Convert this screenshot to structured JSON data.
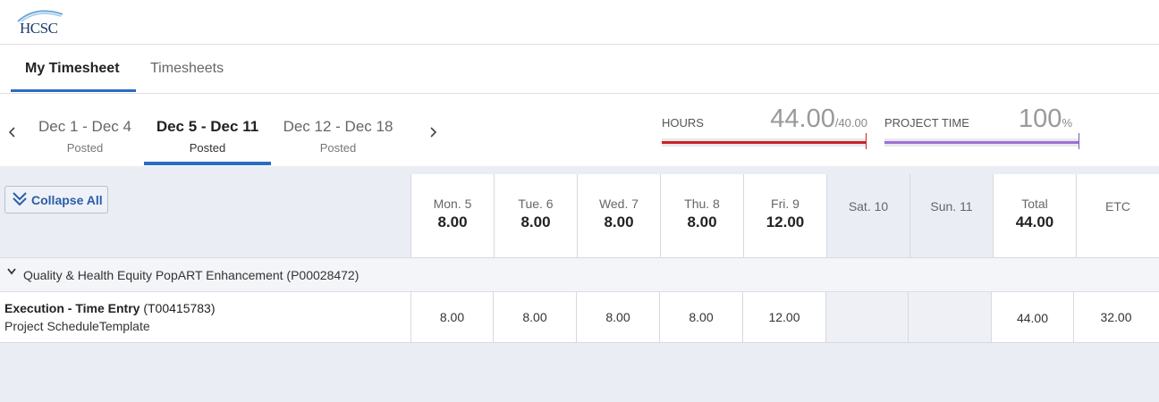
{
  "brand": {
    "logo_text": "HCSC",
    "accent": "#2b6cc4"
  },
  "tabs": [
    {
      "label": "My Timesheet",
      "active": true
    },
    {
      "label": "Timesheets",
      "active": false
    }
  ],
  "weeks": [
    {
      "range": "Dec 1 - Dec 4",
      "status": "Posted"
    },
    {
      "range": "Dec 5 - Dec 11",
      "status": "Posted",
      "active": true
    },
    {
      "range": "Dec 12 - Dec 18",
      "status": "Posted"
    }
  ],
  "nav_icons": {
    "prev": "chevron-left-icon",
    "next": "chevron-right-icon"
  },
  "summary": {
    "hours": {
      "label": "HOURS",
      "value": "44.00",
      "target": "/40.00",
      "color": "#cc2222",
      "fraction": 1.0
    },
    "project_time": {
      "label": "PROJECT TIME",
      "value": "100",
      "unit": "%",
      "color": "#9b6fd6",
      "fraction": 1.0
    }
  },
  "grid": {
    "collapse_label": "Collapse All",
    "days": [
      {
        "name": "Mon. 5",
        "hours": "8.00"
      },
      {
        "name": "Tue. 6",
        "hours": "8.00"
      },
      {
        "name": "Wed. 7",
        "hours": "8.00"
      },
      {
        "name": "Thu. 8",
        "hours": "8.00"
      },
      {
        "name": "Fri. 9",
        "hours": "12.00"
      },
      {
        "name": "Sat. 10",
        "hours": ""
      },
      {
        "name": "Sun. 11",
        "hours": ""
      }
    ],
    "total": {
      "name": "Total",
      "hours": "44.00"
    },
    "etc": {
      "name": "ETC"
    },
    "project": {
      "name": "Quality & Health Equity PopART Enhancement (P00028472)"
    },
    "task": {
      "title": "Execution - Time Entry",
      "code": "(T00415783)",
      "subtitle": "Project ScheduleTemplate",
      "values": [
        "8.00",
        "8.00",
        "8.00",
        "8.00",
        "12.00",
        "",
        ""
      ],
      "total": "44.00",
      "etc": "32.00"
    }
  }
}
